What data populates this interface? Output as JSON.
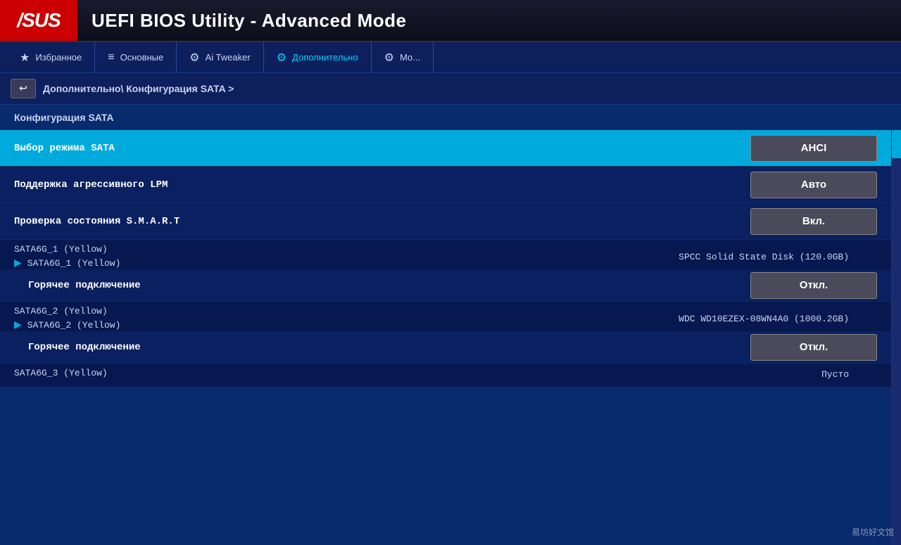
{
  "header": {
    "logo": "/SUS",
    "title": "UEFI BIOS Utility - Advanced Mode"
  },
  "navbar": {
    "items": [
      {
        "id": "favorites",
        "icon": "★",
        "label": "Избранное"
      },
      {
        "id": "main",
        "icon": "≡",
        "label": "Основные"
      },
      {
        "id": "ai_tweaker",
        "icon": "⚙",
        "label": "Ai Tweaker"
      },
      {
        "id": "advanced",
        "icon": "⚙",
        "label": "Дополнительно",
        "active": true
      },
      {
        "id": "monitor",
        "icon": "⚙",
        "label": "Мо..."
      }
    ]
  },
  "breadcrumb": {
    "back_label": "↩",
    "path": "Дополнительно\\ Конфигурация SATA >"
  },
  "page_title": "Конфигурация SATA",
  "settings": [
    {
      "id": "sata_mode",
      "label": "Выбор режима SATA",
      "value": "AHCI",
      "highlighted": true
    },
    {
      "id": "lpm",
      "label": "Поддержка агрессивного LPM",
      "value": "Авто",
      "highlighted": false
    },
    {
      "id": "smart",
      "label": "Проверка состояния S.M.A.R.T",
      "value": "Вкл.",
      "highlighted": false
    }
  ],
  "sata_devices": [
    {
      "port": "SATA6G_1 (Yellow)",
      "device_link": "SATA6G_1 (Yellow)",
      "disk_info": "SPCC Solid State Disk (120.0GB)",
      "hotplug_label": "Горячее подключение",
      "hotplug_value": "Откл."
    },
    {
      "port": "SATA6G_2 (Yellow)",
      "device_link": "SATA6G_2 (Yellow)",
      "disk_info": "WDC WD10EZEX-08WN4A0 (1000.2GB)",
      "hotplug_label": "Горячее подключение",
      "hotplug_value": "Откл."
    },
    {
      "port": "SATA6G_3 (Yellow)",
      "device_link": "",
      "disk_info": "Пусто",
      "hotplug_label": "",
      "hotplug_value": ""
    }
  ],
  "watermark": "易坊好文馆"
}
